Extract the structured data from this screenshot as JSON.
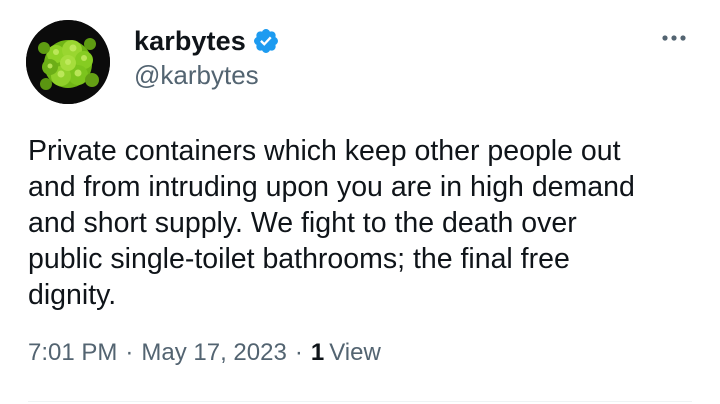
{
  "author": {
    "display_name": "karbytes",
    "handle": "@karbytes",
    "verified": true,
    "avatar_icon": "romanesco-broccoli-avatar",
    "verified_color": "#1d9bf0"
  },
  "post": {
    "text": "Private containers which keep other people out\nand from intruding upon you are in high demand\nand short supply. We fight to the death over\npublic single-toilet bathrooms; the final free\ndignity.",
    "time": "7:01 PM",
    "separator_1": "·",
    "date": "May 17, 2023",
    "separator_2": "·",
    "views_count": "1",
    "views_label": "View"
  },
  "icons": {
    "more": "more-options-icon",
    "verified": "verified-badge-icon"
  },
  "colors": {
    "text_primary": "#0f1419",
    "text_secondary": "#536471",
    "divider": "#eff3f4"
  }
}
